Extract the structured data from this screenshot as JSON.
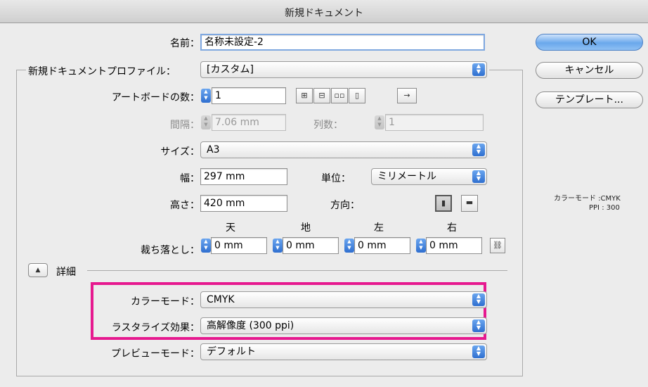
{
  "window": {
    "title": "新規ドキュメント"
  },
  "form": {
    "name_label": "名前：",
    "name_value": "名称未設定-2",
    "profile_label": "新規ドキュメントプロファイル：",
    "profile_value": "[カスタム]",
    "artboard_count_label": "アートボードの数：",
    "artboard_count_value": "1",
    "spacing_label": "間隔：",
    "spacing_value": "7.06 mm",
    "columns_label": "列数：",
    "columns_value": "1",
    "size_label": "サイズ：",
    "size_value": "A3",
    "width_label": "幅：",
    "width_value": "297 mm",
    "units_label": "単位：",
    "units_value": "ミリメートル",
    "height_label": "高さ：",
    "height_value": "420 mm",
    "orientation_label": "方向：",
    "bleed_label": "裁ち落とし：",
    "bleed": {
      "top_label": "天",
      "top_value": "0 mm",
      "bottom_label": "地",
      "bottom_value": "0 mm",
      "left_label": "左",
      "left_value": "0 mm",
      "right_label": "右",
      "right_value": "0 mm"
    },
    "advanced_label": "詳細",
    "color_mode_label": "カラーモード：",
    "color_mode_value": "CMYK",
    "raster_label": "ラスタライズ効果：",
    "raster_value": "高解像度 (300 ppi)",
    "preview_label": "プレビューモード：",
    "preview_value": "デフォルト"
  },
  "buttons": {
    "ok": "OK",
    "cancel": "キャンセル",
    "template": "テンプレート..."
  },
  "info": {
    "color_mode": "カラーモード :CMYK",
    "ppi": "PPI : 300"
  },
  "colors": {
    "highlight": "#e6198f",
    "accent": "#3a7ad8"
  }
}
